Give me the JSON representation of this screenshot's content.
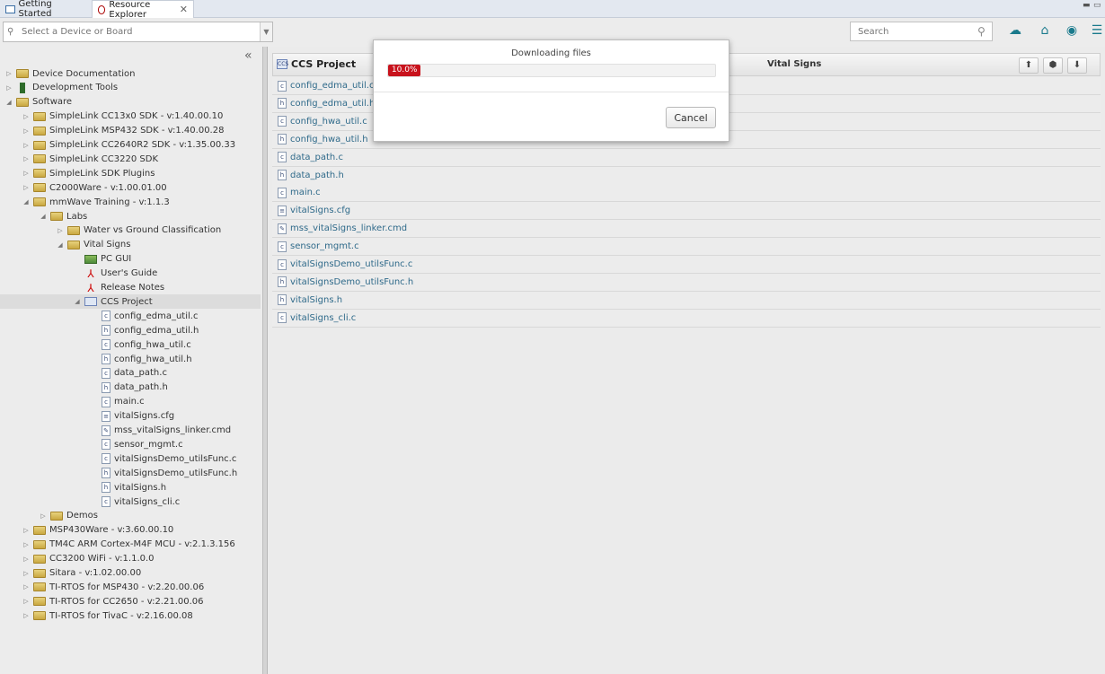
{
  "tabs": [
    {
      "label": "Getting Started",
      "active": false
    },
    {
      "label": "Resource Explorer",
      "active": true,
      "close_glyph": "✕"
    }
  ],
  "window_controls": {
    "minimize": "▬",
    "maximize": "▭"
  },
  "device_select": {
    "placeholder": "Select a Device or Board",
    "dropdown_glyph": "▼"
  },
  "search": {
    "placeholder": "Search"
  },
  "toolbar": {
    "icons": [
      "cloud-icon",
      "home-icon",
      "eye-icon",
      "menu-icon"
    ],
    "accent": "#1a7a8c"
  },
  "left_panel": {
    "collapse_glyph": "«",
    "tree": [
      {
        "level": 0,
        "toggle": "▷",
        "icon": "folder",
        "label": "Device Documentation"
      },
      {
        "level": 0,
        "toggle": "▷",
        "icon": "devtool",
        "label": "Development Tools"
      },
      {
        "level": 0,
        "toggle": "◢",
        "icon": "folder",
        "label": "Software"
      },
      {
        "level": 1,
        "toggle": "▷",
        "icon": "folder",
        "label": "SimpleLink CC13x0 SDK - v:1.40.00.10"
      },
      {
        "level": 1,
        "toggle": "▷",
        "icon": "folder",
        "label": "SimpleLink MSP432 SDK - v:1.40.00.28"
      },
      {
        "level": 1,
        "toggle": "▷",
        "icon": "folder",
        "label": "SimpleLink CC2640R2 SDK - v:1.35.00.33"
      },
      {
        "level": 1,
        "toggle": "▷",
        "icon": "folder",
        "label": "SimpleLink CC3220 SDK"
      },
      {
        "level": 1,
        "toggle": "▷",
        "icon": "folder",
        "label": "SimpleLink SDK Plugins"
      },
      {
        "level": 1,
        "toggle": "▷",
        "icon": "folder",
        "label": "C2000Ware - v:1.00.01.00"
      },
      {
        "level": 1,
        "toggle": "◢",
        "icon": "folder",
        "label": "mmWave Training - v:1.1.3"
      },
      {
        "level": 2,
        "toggle": "◢",
        "icon": "folder",
        "label": "Labs"
      },
      {
        "level": 3,
        "toggle": "▷",
        "icon": "folder",
        "label": "Water vs Ground Classification"
      },
      {
        "level": 3,
        "toggle": "◢",
        "icon": "folder",
        "label": "Vital Signs"
      },
      {
        "level": 4,
        "toggle": "",
        "icon": "gui",
        "label": "PC GUI"
      },
      {
        "level": 4,
        "toggle": "",
        "icon": "pdf",
        "label": "User's Guide"
      },
      {
        "level": 4,
        "toggle": "",
        "icon": "pdf",
        "label": "Release Notes"
      },
      {
        "level": 4,
        "toggle": "◢",
        "icon": "proj",
        "label": "CCS Project",
        "selected": true
      },
      {
        "level": 5,
        "toggle": "",
        "icon": "c",
        "label": "config_edma_util.c"
      },
      {
        "level": 5,
        "toggle": "",
        "icon": "h",
        "label": "config_edma_util.h"
      },
      {
        "level": 5,
        "toggle": "",
        "icon": "c",
        "label": "config_hwa_util.c"
      },
      {
        "level": 5,
        "toggle": "",
        "icon": "h",
        "label": "config_hwa_util.h"
      },
      {
        "level": 5,
        "toggle": "",
        "icon": "c",
        "label": "data_path.c"
      },
      {
        "level": 5,
        "toggle": "",
        "icon": "h",
        "label": "data_path.h"
      },
      {
        "level": 5,
        "toggle": "",
        "icon": "c",
        "label": "main.c"
      },
      {
        "level": 5,
        "toggle": "",
        "icon": "cfg",
        "label": "vitalSigns.cfg"
      },
      {
        "level": 5,
        "toggle": "",
        "icon": "cmd",
        "label": "mss_vitalSigns_linker.cmd"
      },
      {
        "level": 5,
        "toggle": "",
        "icon": "c",
        "label": "sensor_mgmt.c"
      },
      {
        "level": 5,
        "toggle": "",
        "icon": "c",
        "label": "vitalSignsDemo_utilsFunc.c"
      },
      {
        "level": 5,
        "toggle": "",
        "icon": "h",
        "label": "vitalSignsDemo_utilsFunc.h"
      },
      {
        "level": 5,
        "toggle": "",
        "icon": "h",
        "label": "vitalSigns.h"
      },
      {
        "level": 5,
        "toggle": "",
        "icon": "c",
        "label": "vitalSigns_cli.c"
      },
      {
        "level": 2,
        "toggle": "▷",
        "icon": "folder",
        "label": "Demos"
      },
      {
        "level": 1,
        "toggle": "▷",
        "icon": "folder",
        "label": "MSP430Ware - v:3.60.00.10"
      },
      {
        "level": 1,
        "toggle": "▷",
        "icon": "folder",
        "label": "TM4C ARM Cortex-M4F MCU - v:2.1.3.156"
      },
      {
        "level": 1,
        "toggle": "▷",
        "icon": "folder",
        "label": "CC3200 WiFi - v:1.1.0.0"
      },
      {
        "level": 1,
        "toggle": "▷",
        "icon": "folder",
        "label": "Sitara - v:1.02.00.00"
      },
      {
        "level": 1,
        "toggle": "▷",
        "icon": "folder",
        "label": "TI-RTOS for MSP430 - v:2.20.00.06"
      },
      {
        "level": 1,
        "toggle": "▷",
        "icon": "folder",
        "label": "TI-RTOS for CC2650 - v:2.21.00.06"
      },
      {
        "level": 1,
        "toggle": "▷",
        "icon": "folder",
        "label": "TI-RTOS for TivaC - v:2.16.00.08"
      }
    ]
  },
  "content": {
    "header_title": "CCS Project",
    "header_icon_text": "CCS",
    "header_center": "Vital Signs",
    "header_buttons": [
      {
        "name": "up-button",
        "glyph": "⬆"
      },
      {
        "name": "import-button",
        "glyph": "⬢"
      },
      {
        "name": "download-button",
        "glyph": "⬇"
      }
    ],
    "files": [
      {
        "icon": "c",
        "name": "config_edma_util.c"
      },
      {
        "icon": "h",
        "name": "config_edma_util.h"
      },
      {
        "icon": "c",
        "name": "config_hwa_util.c"
      },
      {
        "icon": "h",
        "name": "config_hwa_util.h"
      },
      {
        "icon": "c",
        "name": "data_path.c"
      },
      {
        "icon": "h",
        "name": "data_path.h"
      },
      {
        "icon": "c",
        "name": "main.c"
      },
      {
        "icon": "cfg",
        "name": "vitalSigns.cfg"
      },
      {
        "icon": "cmd",
        "name": "mss_vitalSigns_linker.cmd"
      },
      {
        "icon": "c",
        "name": "sensor_mgmt.c"
      },
      {
        "icon": "c",
        "name": "vitalSignsDemo_utilsFunc.c"
      },
      {
        "icon": "h",
        "name": "vitalSignsDemo_utilsFunc.h"
      },
      {
        "icon": "h",
        "name": "vitalSigns.h"
      },
      {
        "icon": "c",
        "name": "vitalSigns_cli.c"
      }
    ]
  },
  "modal": {
    "title": "Downloading files",
    "progress_label": "10.0%",
    "progress_fraction": 0.1,
    "progress_color": "#c8121c",
    "cancel_label": "Cancel"
  }
}
